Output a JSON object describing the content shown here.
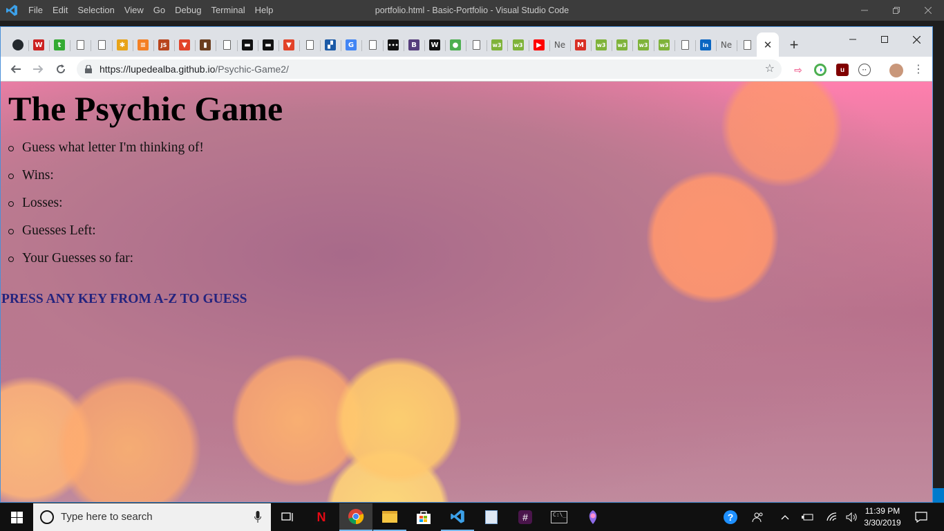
{
  "vscode": {
    "menu": [
      "File",
      "Edit",
      "Selection",
      "View",
      "Go",
      "Debug",
      "Terminal",
      "Help"
    ],
    "title": "portfolio.html - Basic-Portfolio - Visual Studio Code",
    "accent": "#007acc"
  },
  "chrome": {
    "tabs": [
      {
        "icon": "github-icon",
        "glyph": "",
        "color": "#24292e"
      },
      {
        "icon": "codepen-red-icon",
        "glyph": "W",
        "color": "#cc2222"
      },
      {
        "icon": "t-green-icon",
        "glyph": "t",
        "color": "#33aa33"
      },
      {
        "icon": "document-icon",
        "glyph": "",
        "color": "doc"
      },
      {
        "icon": "document-icon",
        "glyph": "",
        "color": "doc"
      },
      {
        "icon": "slack-icon",
        "glyph": "✱",
        "color": "#e8a317"
      },
      {
        "icon": "stackoverflow-icon",
        "glyph": "≡",
        "color": "#f48024"
      },
      {
        "icon": "javascript-icon",
        "glyph": "JS",
        "color": "#b8441c"
      },
      {
        "icon": "gitlab-icon",
        "glyph": "▼",
        "color": "#e24329"
      },
      {
        "icon": "book-icon",
        "glyph": "▮",
        "color": "#6b3e1f"
      },
      {
        "icon": "document-icon",
        "glyph": "",
        "color": "doc"
      },
      {
        "icon": "terminal-icon",
        "glyph": "▬",
        "color": "#111111"
      },
      {
        "icon": "terminal-icon",
        "glyph": "▬",
        "color": "#111111"
      },
      {
        "icon": "gitlab-icon",
        "glyph": "▼",
        "color": "#e24329"
      },
      {
        "icon": "document-icon",
        "glyph": "",
        "color": "doc"
      },
      {
        "icon": "sheets-icon",
        "glyph": "▞",
        "color": "#1c5aa6"
      },
      {
        "icon": "google-icon",
        "glyph": "G",
        "color": "#4285f4"
      },
      {
        "icon": "document-icon",
        "glyph": "",
        "color": "doc"
      },
      {
        "icon": "dots-icon",
        "glyph": "•••",
        "color": "#111111"
      },
      {
        "icon": "bootstrap-icon",
        "glyph": "B",
        "color": "#563d7c"
      },
      {
        "icon": "wikipedia-icon",
        "glyph": "W",
        "color": "#111111"
      },
      {
        "icon": "leaf-icon",
        "glyph": "●",
        "color": "#4caf50"
      },
      {
        "icon": "document-icon",
        "glyph": "",
        "color": "doc"
      },
      {
        "icon": "w3schools-icon",
        "glyph": "w3",
        "color": "#7fb33a"
      },
      {
        "icon": "w3schools-icon",
        "glyph": "w3",
        "color": "#7fb33a"
      },
      {
        "icon": "youtube-icon",
        "glyph": "▶",
        "color": "#ff0000"
      },
      {
        "icon": "netflix-text-icon",
        "glyph": "Ne",
        "color": "text"
      },
      {
        "icon": "gmail-icon",
        "glyph": "M",
        "color": "#d93025"
      },
      {
        "icon": "w3schools-icon",
        "glyph": "w3",
        "color": "#7fb33a"
      },
      {
        "icon": "w3schools-icon",
        "glyph": "w3",
        "color": "#7fb33a"
      },
      {
        "icon": "w3schools-icon",
        "glyph": "w3",
        "color": "#7fb33a"
      },
      {
        "icon": "w3schools-icon",
        "glyph": "w3",
        "color": "#7fb33a"
      },
      {
        "icon": "document-icon",
        "glyph": "",
        "color": "doc"
      },
      {
        "icon": "linkedin-icon",
        "glyph": "in",
        "color": "#0a66c2"
      },
      {
        "icon": "netflix-text-icon",
        "glyph": "Ne",
        "color": "text"
      },
      {
        "icon": "document-icon",
        "glyph": "",
        "color": "doc"
      }
    ],
    "address": {
      "host": "https://lupedealba.github.io",
      "path": "/Psychic-Game2/"
    }
  },
  "page": {
    "heading": "The Psychic Game",
    "items": [
      "Guess what letter I'm thinking of!",
      "Wins:",
      "Losses:",
      "Guesses Left:",
      "Your Guesses so far:"
    ],
    "prompt": "PRESS ANY KEY FROM A-Z TO GUESS",
    "prompt_color": "#24237e"
  },
  "taskbar": {
    "search_placeholder": "Type here to search",
    "apps": [
      "task-view-icon",
      "netflix-icon",
      "chrome-icon",
      "file-explorer-icon",
      "store-icon",
      "vscode-icon",
      "notepad-icon",
      "slack-icon",
      "terminal-icon",
      "paint-icon"
    ],
    "clock_time": "11:39 PM",
    "clock_date": "3/30/2019"
  }
}
